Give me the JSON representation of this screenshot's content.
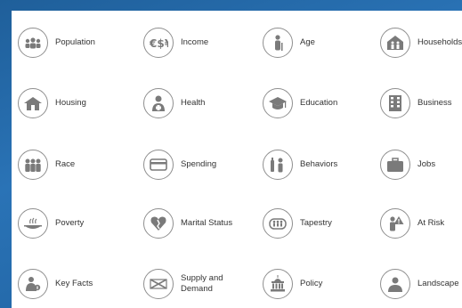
{
  "items": [
    {
      "label": "Population",
      "icon": "population-icon"
    },
    {
      "label": "Income",
      "icon": "income-icon"
    },
    {
      "label": "Age",
      "icon": "age-icon"
    },
    {
      "label": "Households",
      "icon": "households-icon"
    },
    {
      "label": "Housing",
      "icon": "housing-icon"
    },
    {
      "label": "Health",
      "icon": "health-icon"
    },
    {
      "label": "Education",
      "icon": "education-icon"
    },
    {
      "label": "Business",
      "icon": "business-icon"
    },
    {
      "label": "Race",
      "icon": "race-icon"
    },
    {
      "label": "Spending",
      "icon": "spending-icon"
    },
    {
      "label": "Behaviors",
      "icon": "behaviors-icon"
    },
    {
      "label": "Jobs",
      "icon": "jobs-icon"
    },
    {
      "label": "Poverty",
      "icon": "poverty-icon"
    },
    {
      "label": "Marital Status",
      "icon": "marital-status-icon"
    },
    {
      "label": "Tapestry",
      "icon": "tapestry-icon"
    },
    {
      "label": "At Risk",
      "icon": "at-risk-icon"
    },
    {
      "label": "Key Facts",
      "icon": "key-facts-icon"
    },
    {
      "label": "Supply and\nDemand",
      "icon": "supply-and-demand-icon"
    },
    {
      "label": "Policy",
      "icon": "policy-icon"
    },
    {
      "label": "Landscape",
      "icon": "landscape-icon"
    }
  ],
  "colors": {
    "background": "#2a73b6",
    "icon_fill": "#7a7a7a",
    "icon_border": "#8f8f8f",
    "text": "#333333"
  }
}
